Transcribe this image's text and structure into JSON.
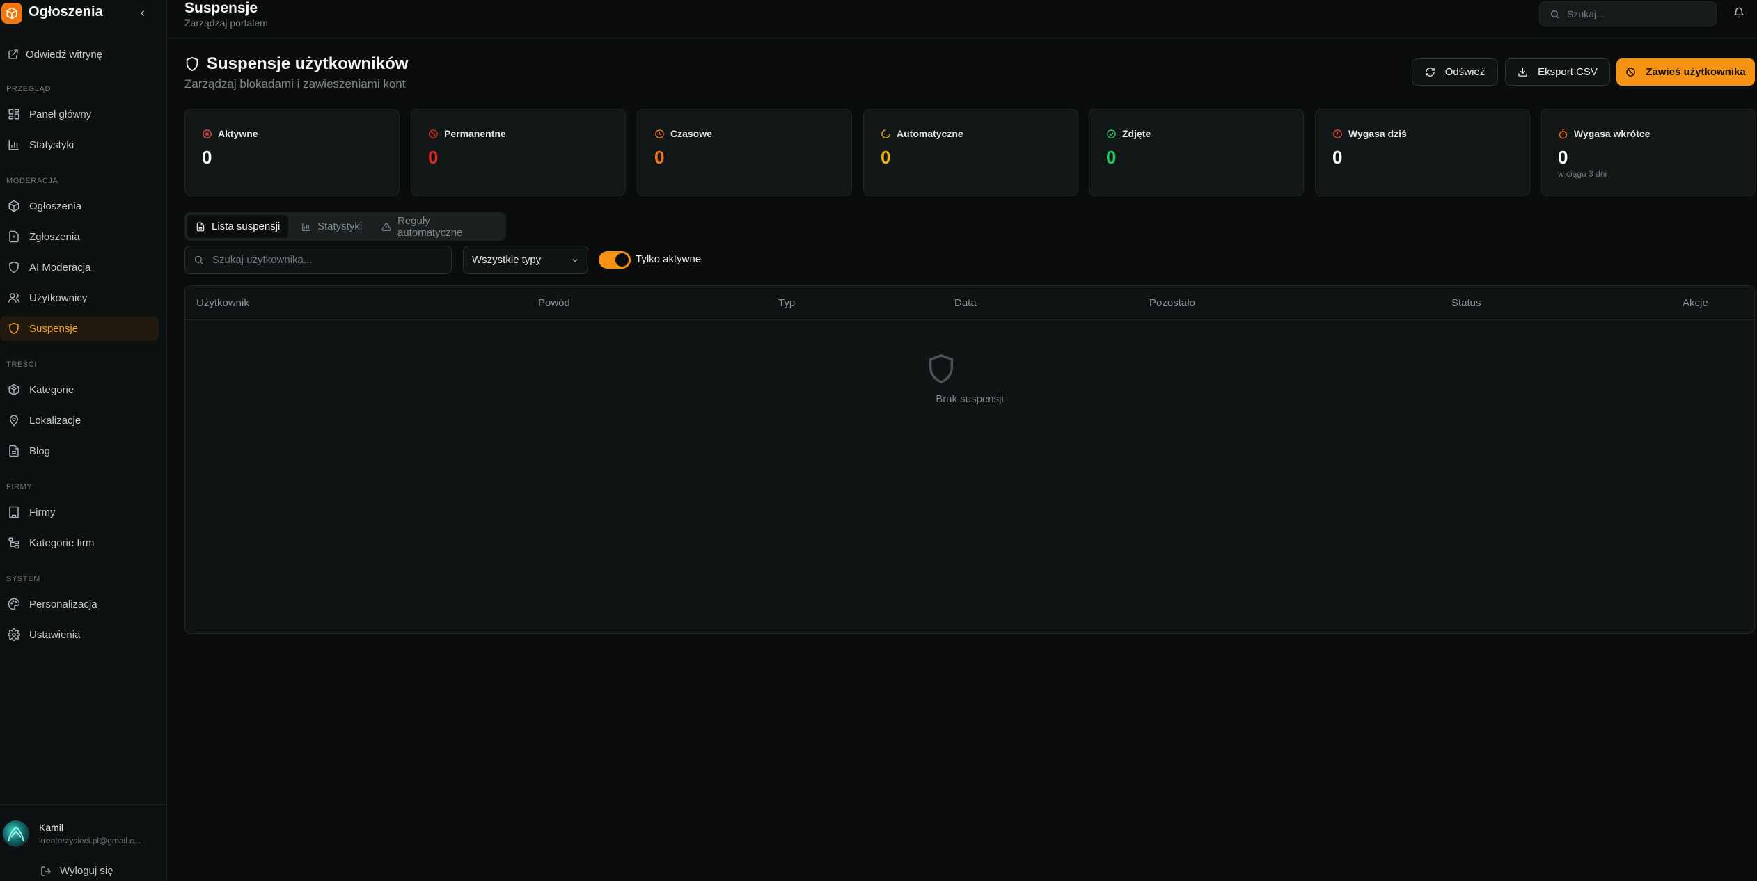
{
  "sidebar": {
    "brand": "Ogłoszenia",
    "visit_link": "Odwiedź witrynę",
    "sections": [
      {
        "label": "PRZEGLĄD",
        "items": [
          {
            "label": "Panel główny",
            "icon": "dashboard-icon"
          },
          {
            "label": "Statystyki",
            "icon": "bar-chart-icon"
          }
        ]
      },
      {
        "label": "MODERACJA",
        "items": [
          {
            "label": "Ogłoszenia",
            "icon": "package-icon"
          },
          {
            "label": "Zgłoszenia",
            "icon": "report-icon"
          },
          {
            "label": "AI Moderacja",
            "icon": "shield-icon"
          },
          {
            "label": "Użytkownicy",
            "icon": "users-icon"
          },
          {
            "label": "Suspensje",
            "icon": "shield-icon",
            "active": true
          }
        ]
      },
      {
        "label": "TREŚCI",
        "items": [
          {
            "label": "Kategorie",
            "icon": "box-icon"
          },
          {
            "label": "Lokalizacje",
            "icon": "map-pin-icon"
          },
          {
            "label": "Blog",
            "icon": "document-icon"
          }
        ]
      },
      {
        "label": "FIRMY",
        "items": [
          {
            "label": "Firmy",
            "icon": "building-icon"
          },
          {
            "label": "Kategorie firm",
            "icon": "tree-icon"
          }
        ]
      },
      {
        "label": "SYSTEM",
        "items": [
          {
            "label": "Personalizacja",
            "icon": "palette-icon"
          },
          {
            "label": "Ustawienia",
            "icon": "gear-icon"
          }
        ]
      }
    ],
    "user": {
      "name": "Kamil",
      "email": "kreatorzysieci.pl@gmail.c..."
    },
    "logout": "Wyloguj się"
  },
  "header": {
    "title": "Suspensje",
    "subtitle": "Zarządzaj portalem",
    "search_placeholder": "Szukaj..."
  },
  "main": {
    "title": "Suspensje użytkowników",
    "subtitle": "Zarządzaj blokadami i zawieszeniami kont",
    "buttons": {
      "refresh": "Odśwież",
      "export": "Eksport CSV",
      "suspend": "Zawieś użytkownika"
    },
    "stats": [
      {
        "label": "Aktywne",
        "value": "0",
        "color": "#ef4444",
        "icon": "x-circle-icon"
      },
      {
        "label": "Permanentne",
        "value": "0",
        "color": "#dc2626",
        "icon": "ban-icon"
      },
      {
        "label": "Czasowe",
        "value": "0",
        "color": "#f97316",
        "icon": "clock-icon"
      },
      {
        "label": "Automatyczne",
        "value": "0",
        "color": "#eab308",
        "icon": "loader-icon"
      },
      {
        "label": "Zdjęte",
        "value": "0",
        "color": "#22c55e",
        "icon": "check-circle-icon"
      },
      {
        "label": "Wygasa dziś",
        "value": "0",
        "color": "#ffffff",
        "icon": "alert-circle-icon"
      },
      {
        "label": "Wygasa wkrótce",
        "value": "0",
        "color": "#ffffff",
        "icon": "timer-icon",
        "note": "w ciągu 3 dni"
      }
    ],
    "tabs": [
      {
        "label": "Lista suspensji",
        "icon": "file-icon",
        "active": true
      },
      {
        "label": "Statystyki",
        "icon": "bar-chart-icon"
      },
      {
        "label": "Reguły automatyczne",
        "icon": "warning-icon"
      }
    ],
    "filters": {
      "search_placeholder": "Szukaj użytkownika...",
      "type_selected": "Wszystkie typy",
      "only_active_label": "Tylko aktywne",
      "only_active": true
    },
    "table": {
      "columns": [
        "Użytkownik",
        "Powód",
        "Typ",
        "Data",
        "Pozostało",
        "Status",
        "Akcje"
      ],
      "empty_text": "Brak suspensji"
    }
  },
  "colors": {
    "accent": "#f59214",
    "background": "#0b0d0d"
  }
}
